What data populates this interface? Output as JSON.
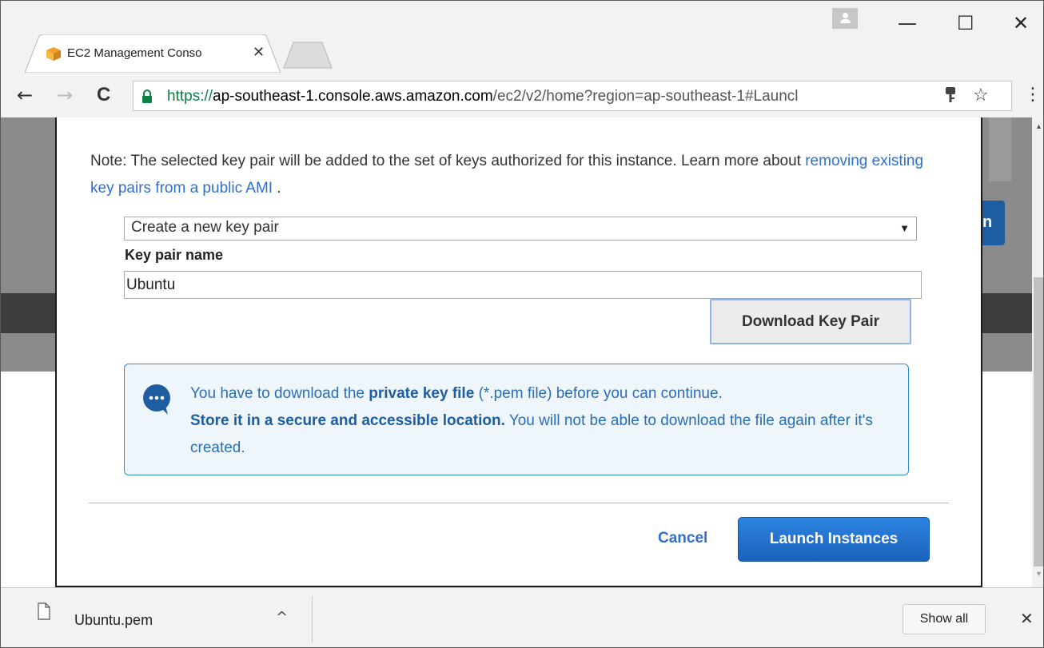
{
  "browser": {
    "tab_title": "EC2 Management Conso",
    "url_scheme": "https://",
    "url_host": "ap-southeast-1.console.aws.amazon.com",
    "url_path": "/ec2/v2/home?region=ap-southeast-1#Launcl",
    "window_controls": {
      "minimize": "—",
      "maximize": "☐",
      "close": "✕"
    },
    "nav": {
      "back": "←",
      "forward": "→",
      "reload": "C",
      "bookmark": "☆",
      "menu": "⋮",
      "key": "🔑"
    },
    "tab_close": "✕"
  },
  "modal": {
    "note_prefix": "Note: The selected key pair will be added to the set of keys authorized for this instance. Learn more about ",
    "note_link": "removing existing key pairs from a public AMI",
    "note_suffix": " .",
    "select_value": "Create a new key pair",
    "key_pair_label": "Key pair name",
    "key_pair_value": "Ubuntu",
    "download_button": "Download Key Pair",
    "alert": {
      "line1_prefix": "You have to download the ",
      "line1_bold": "private key file",
      "line1_suffix": " (*.pem file) before you can continue.",
      "line2_bold": "Store it in a secure and accessible location.",
      "line2_suffix": " You will not be able to download the file again after it's created."
    },
    "cancel_label": "Cancel",
    "launch_label": "Launch Instances"
  },
  "background": {
    "blue_button_letter": "n"
  },
  "download_shelf": {
    "file_name": "Ubuntu.pem",
    "caret": "^",
    "show_all": "Show all",
    "close": "✕"
  },
  "colors": {
    "link": "#2e6fcf",
    "launch_button": "#1a62bd",
    "alert_border": "#2c8fd6",
    "secure_green": "#0b8043"
  }
}
